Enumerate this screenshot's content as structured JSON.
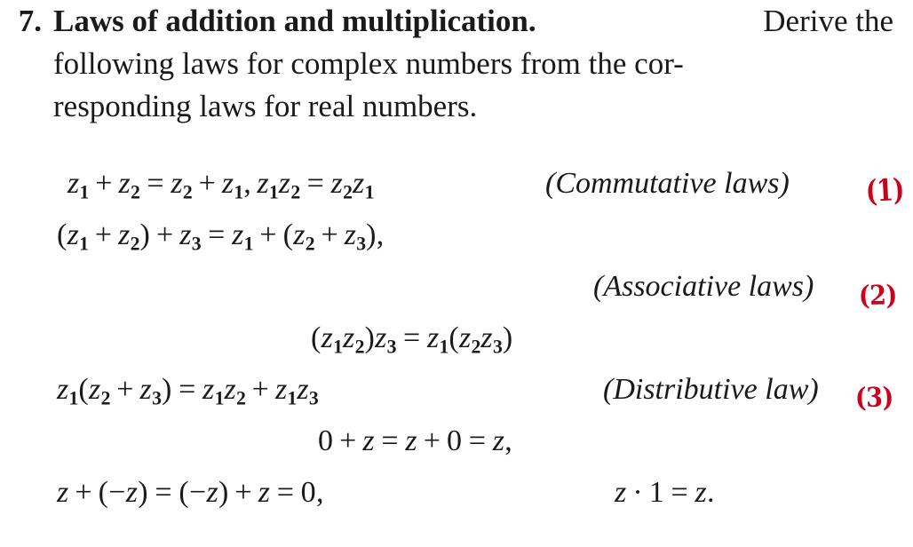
{
  "page": {
    "background_color": "#ffffff",
    "text_color": "#1a1a1a",
    "annotation_color": "#c8041c"
  },
  "problem": {
    "number": "7.",
    "title": "Laws of addition and multiplication.",
    "line1_rest": "Derive the",
    "line2": "following laws for complex numbers from the cor-",
    "line3": "responding laws for real numbers."
  },
  "equations": {
    "commutative": {
      "line": "z1 + z2 = z2 + z1, z1z2 = z2z1",
      "caption": "(Commutative laws)",
      "annotation": "(1)"
    },
    "associative": {
      "line_a": "(z1 + z2) + z3 = z1 + (z2 + z3),",
      "caption": "(Associative laws)",
      "annotation": "(2)",
      "line_b": "(z1z2)z3 = z1(z2z3)"
    },
    "distributive": {
      "line": "z1(z2 + z3) = z1z2 + z1z3",
      "caption": "(Distributive law)",
      "annotation": "(3)"
    },
    "identity": {
      "line": "0 + z = z + 0 = z,"
    },
    "inverse": {
      "line_left": "z + (-z) = (-z) + z = 0,",
      "line_right": "z . 1 = z."
    }
  },
  "glyphs": {
    "plus": "+",
    "minus": "−",
    "equals": "=",
    "cdot": "·",
    "comma": ",",
    "period": ".",
    "lparen": "(",
    "rparen": ")",
    "zero": "0",
    "one": "1",
    "var_z": "z",
    "sub_1": "1",
    "sub_2": "2",
    "sub_3": "3"
  }
}
